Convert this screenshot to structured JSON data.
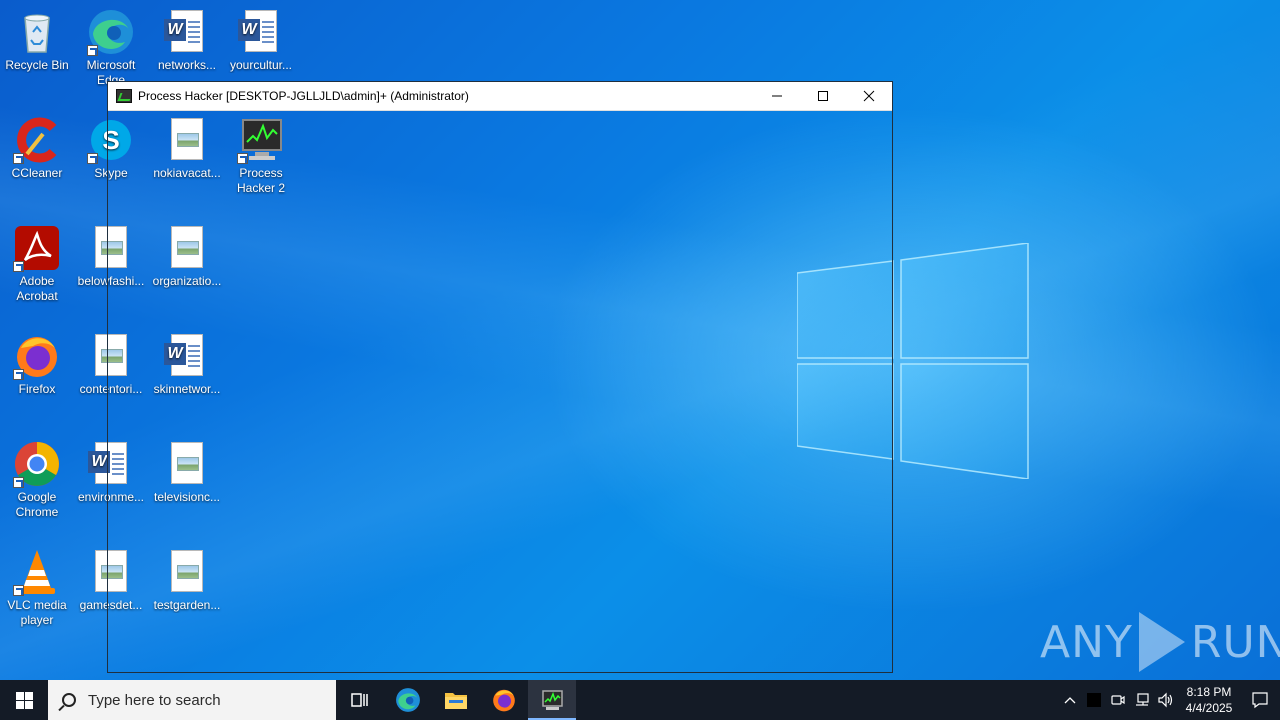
{
  "desktop": {
    "icons": [
      {
        "label": "Recycle Bin",
        "icon": "recycle-bin-icon"
      },
      {
        "label": "Microsoft Edge",
        "icon": "edge-icon"
      },
      {
        "label": "networks...",
        "icon": "word-doc-icon"
      },
      {
        "label": "yourcultur...",
        "icon": "word-doc-icon"
      },
      {
        "label": "CCleaner",
        "icon": "ccleaner-icon"
      },
      {
        "label": "Skype",
        "icon": "skype-icon"
      },
      {
        "label": "nokiavacat...",
        "icon": "image-file-icon"
      },
      {
        "label": "Process Hacker 2",
        "icon": "process-hacker-icon"
      },
      {
        "label": "Adobe Acrobat",
        "icon": "acrobat-icon"
      },
      {
        "label": "belowfashi...",
        "icon": "image-file-icon"
      },
      {
        "label": "organizatio...",
        "icon": "image-file-icon"
      },
      {
        "label": "Firefox",
        "icon": "firefox-icon"
      },
      {
        "label": "contentori...",
        "icon": "image-file-icon"
      },
      {
        "label": "skinnetwor...",
        "icon": "word-doc-icon"
      },
      {
        "label": "Google Chrome",
        "icon": "chrome-icon"
      },
      {
        "label": "environme...",
        "icon": "word-doc-icon"
      },
      {
        "label": "televisionc...",
        "icon": "image-file-icon"
      },
      {
        "label": "VLC media player",
        "icon": "vlc-icon"
      },
      {
        "label": "gamesdet...",
        "icon": "image-file-icon"
      },
      {
        "label": "testgarden...",
        "icon": "image-file-icon"
      }
    ]
  },
  "window": {
    "title": "Process Hacker [DESKTOP-JGLLJLD\\admin]+ (Administrator)",
    "minimize": "─",
    "maximize": "☐",
    "close": "✕"
  },
  "taskbar": {
    "search_placeholder": "Type here to search",
    "time": "8:18 PM",
    "date": "4/4/2025"
  },
  "watermark": {
    "left": "ANY",
    "right": "RUN"
  },
  "colors": {
    "taskbar": "#141b26",
    "desktop_accent": "#0a78e0"
  }
}
